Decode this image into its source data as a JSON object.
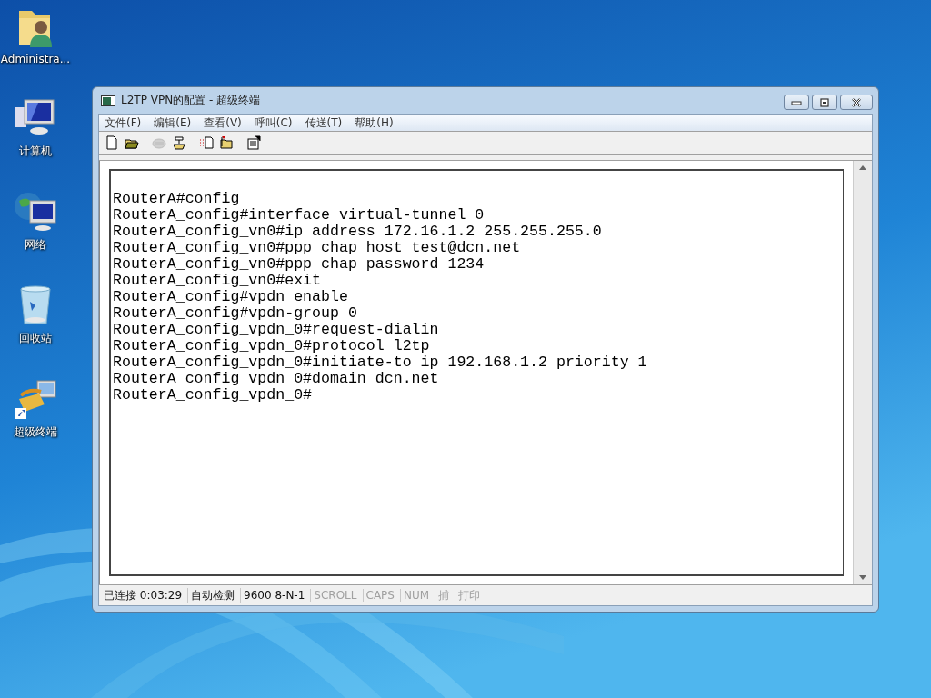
{
  "desktop_icons": [
    {
      "label": "Administra...",
      "kind": "user-folder"
    },
    {
      "label": "计算机",
      "kind": "computer"
    },
    {
      "label": "网络",
      "kind": "network"
    },
    {
      "label": "回收站",
      "kind": "recycle-bin"
    },
    {
      "label": "超级终端",
      "kind": "terminal-shortcut"
    }
  ],
  "window": {
    "title": "L2TP VPN的配置 - 超级终端"
  },
  "menu": [
    "文件(F)",
    "编辑(E)",
    "查看(V)",
    "呼叫(C)",
    "传送(T)",
    "帮助(H)"
  ],
  "toolbar": [
    {
      "kind": "new",
      "disabled": false
    },
    {
      "kind": "open",
      "disabled": false
    },
    {
      "kind": "disconnect",
      "disabled": true
    },
    {
      "kind": "call",
      "disabled": false
    },
    {
      "kind": "send",
      "disabled": false
    },
    {
      "kind": "receive",
      "disabled": false
    },
    {
      "kind": "properties",
      "disabled": false
    }
  ],
  "terminal_lines": [
    "RouterA#config",
    "RouterA_config#interface virtual-tunnel 0",
    "RouterA_config_vn0#ip address 172.16.1.2 255.255.255.0",
    "RouterA_config_vn0#ppp chap host test@dcn.net",
    "RouterA_config_vn0#ppp chap password 1234",
    "RouterA_config_vn0#exit",
    "RouterA_config#vpdn enable",
    "RouterA_config#vpdn-group 0",
    "RouterA_config_vpdn_0#request-dialin",
    "RouterA_config_vpdn_0#protocol l2tp",
    "RouterA_config_vpdn_0#initiate-to ip 192.168.1.2 priority 1",
    "RouterA_config_vpdn_0#domain dcn.net",
    "RouterA_config_vpdn_0#"
  ],
  "status_bar": [
    {
      "text": "已连接 0:03:29",
      "disabled": false
    },
    {
      "text": "自动检测",
      "disabled": false
    },
    {
      "text": "9600 8-N-1",
      "disabled": false
    },
    {
      "text": "SCROLL",
      "disabled": true
    },
    {
      "text": "CAPS",
      "disabled": true
    },
    {
      "text": "NUM",
      "disabled": true
    },
    {
      "text": "捕",
      "disabled": true
    },
    {
      "text": "打印",
      "disabled": true
    }
  ]
}
